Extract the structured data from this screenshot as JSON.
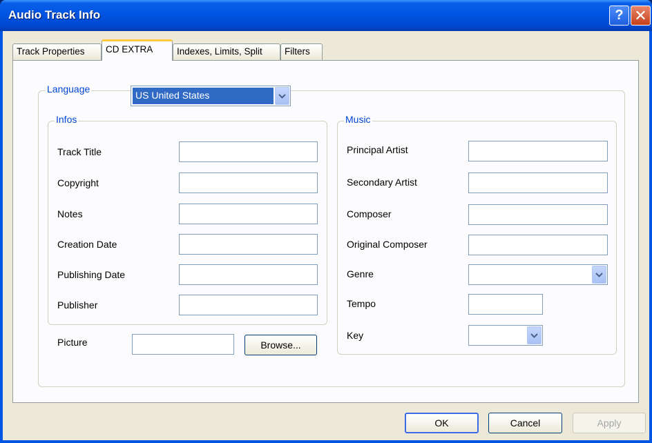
{
  "window": {
    "title": "Audio Track Info",
    "help_glyph": "?",
    "close_glyph": "✕"
  },
  "tabs": [
    {
      "label": "Track Properties"
    },
    {
      "label": "CD EXTRA"
    },
    {
      "label": "Indexes, Limits, Split"
    },
    {
      "label": "Filters"
    }
  ],
  "language": {
    "label": "Language",
    "selected": "US United States"
  },
  "infos": {
    "legend": "Infos",
    "fields": [
      {
        "label": "Track Title",
        "value": ""
      },
      {
        "label": "Copyright",
        "value": ""
      },
      {
        "label": "Notes",
        "value": ""
      },
      {
        "label": "Creation Date",
        "value": ""
      },
      {
        "label": "Publishing Date",
        "value": ""
      },
      {
        "label": "Publisher",
        "value": ""
      }
    ]
  },
  "picture": {
    "label": "Picture",
    "value": "",
    "browse_label": "Browse..."
  },
  "music": {
    "legend": "Music",
    "fields": [
      {
        "label": "Principal Artist",
        "value": ""
      },
      {
        "label": "Secondary Artist",
        "value": ""
      },
      {
        "label": "Composer",
        "value": ""
      },
      {
        "label": "Original Composer",
        "value": ""
      },
      {
        "label": "Genre",
        "value": ""
      },
      {
        "label": "Tempo",
        "value": ""
      },
      {
        "label": "Key",
        "value": ""
      }
    ]
  },
  "footer": {
    "ok_label": "OK",
    "cancel_label": "Cancel",
    "apply_label": "Apply"
  },
  "colors": {
    "titlebar": "#0054e3",
    "accent_tab": "#ffc83c",
    "legend_text": "#0046d5",
    "selection": "#316ac5"
  }
}
